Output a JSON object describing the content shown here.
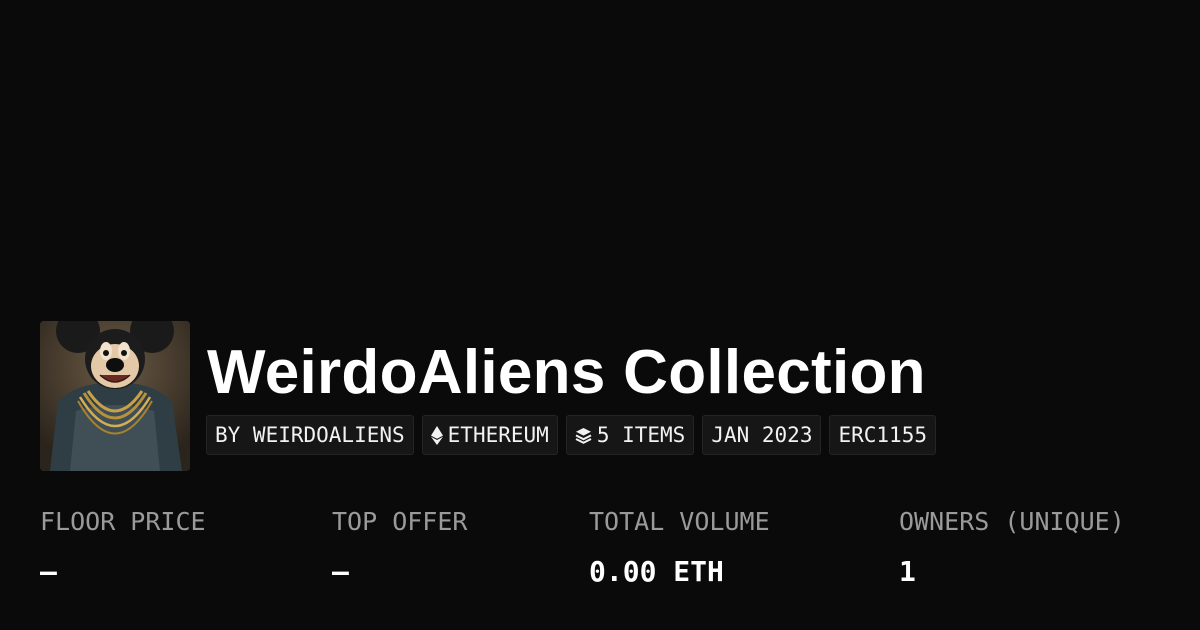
{
  "collection": {
    "title": "WeirdoAliens Collection",
    "avatar_description": "WeirdoAliens collection avatar"
  },
  "badges": [
    {
      "label": "BY WEIRDOALIENS",
      "icon": ""
    },
    {
      "label": "ETHEREUM",
      "icon": "ethereum-icon"
    },
    {
      "label": "5 ITEMS",
      "icon": "layers-icon"
    },
    {
      "label": "JAN 2023",
      "icon": ""
    },
    {
      "label": "ERC1155",
      "icon": ""
    }
  ],
  "stats": [
    {
      "label": "FLOOR PRICE",
      "value": "—"
    },
    {
      "label": "TOP OFFER",
      "value": "—"
    },
    {
      "label": "TOTAL VOLUME",
      "value": "0.00 ETH"
    },
    {
      "label": "OWNERS (UNIQUE)",
      "value": "1"
    }
  ],
  "colors": {
    "background": "#0a0a0a",
    "badge_background": "#161616",
    "label_gray": "#9a9a9a",
    "text_white": "#ffffff"
  }
}
